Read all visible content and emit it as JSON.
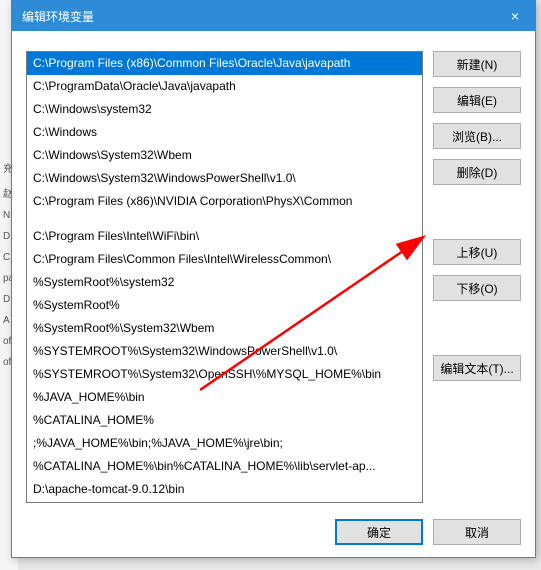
{
  "bg_chars": [
    "充",
    "赵",
    "N",
    "D",
    "C",
    "pa",
    "D",
    "A",
    "of",
    "of"
  ],
  "titlebar": {
    "title": "编辑环境变量",
    "close_icon": "×"
  },
  "list": {
    "items": [
      "C:\\Program Files (x86)\\Common Files\\Oracle\\Java\\javapath",
      "C:\\ProgramData\\Oracle\\Java\\javapath",
      "C:\\Windows\\system32",
      "C:\\Windows",
      "C:\\Windows\\System32\\Wbem",
      "C:\\Windows\\System32\\WindowsPowerShell\\v1.0\\",
      "C:\\Program Files (x86)\\NVIDIA Corporation\\PhysX\\Common",
      " ",
      " ",
      "C:\\Program Files\\Intel\\WiFi\\bin\\",
      "C:\\Program Files\\Common Files\\Intel\\WirelessCommon\\",
      "%SystemRoot%\\system32",
      "%SystemRoot%",
      "%SystemRoot%\\System32\\Wbem",
      "%SYSTEMROOT%\\System32\\WindowsPowerShell\\v1.0\\",
      "%SYSTEMROOT%\\System32\\OpenSSH\\%MYSQL_HOME%\\bin",
      "%JAVA_HOME%\\bin",
      "%CATALINA_HOME%",
      ";%JAVA_HOME%\\bin;%JAVA_HOME%\\jre\\bin;",
      "%CATALINA_HOME%\\bin%CATALINA_HOME%\\lib\\servlet-ap...",
      "D:\\apache-tomcat-9.0.12\\bin"
    ],
    "selected_index": 0
  },
  "buttons": {
    "new": "新建(N)",
    "edit": "编辑(E)",
    "browse": "浏览(B)...",
    "delete": "删除(D)",
    "moveup": "上移(U)",
    "movedown": "下移(O)",
    "edittext": "编辑文本(T)...",
    "ok": "确定",
    "cancel": "取消"
  }
}
